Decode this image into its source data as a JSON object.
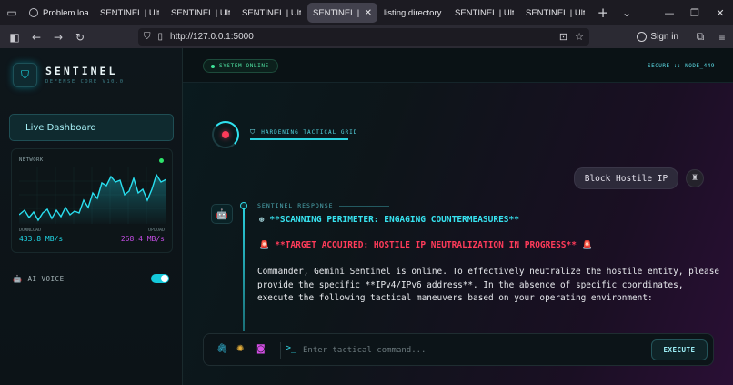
{
  "browser": {
    "tabs": [
      {
        "label": "Problem loadi"
      },
      {
        "label": "SENTINEL | Ultimat"
      },
      {
        "label": "SENTINEL | Ultimat"
      },
      {
        "label": "SENTINEL | Ultimat"
      },
      {
        "label": "SENTINEL | Ultim",
        "active": true
      },
      {
        "label": "listing directory /"
      },
      {
        "label": "SENTINEL | Ultimat"
      },
      {
        "label": "SENTINEL | Ultimat"
      }
    ],
    "url": "http://127.0.0.1:5000",
    "sign_in": "Sign in"
  },
  "sidebar": {
    "brand": "SENTINEL",
    "brand_sub": "DEFENSE CORE V10.0",
    "dashboard_button": "Live Dashboard",
    "network": {
      "title": "NETWORK",
      "download_label": "DOWNLOAD",
      "download_value": "433.8 MB/s",
      "upload_label": "UPLOAD",
      "upload_value": "268.4 MB/s",
      "status_color": "#2ee36b"
    },
    "ai_voice_label": "AI VOICE",
    "ai_voice_on": true
  },
  "header": {
    "status": "SYSTEM ONLINE",
    "secure_label": "SECURE :: NODE_449"
  },
  "chat": {
    "hardening_label": "HARDENING TACTICAL GRID",
    "user_message": "Block Hostile IP",
    "response_label": "SENTINEL RESPONSE",
    "line1": "**SCANNING PERIMETER: ENGAGING COUNTERMEASURES**",
    "line2": "**TARGET ACQUIRED: HOSTILE IP NEUTRALIZATION IN PROGRESS**",
    "body": "Commander, Gemini Sentinel is online. To effectively neutralize the hostile entity, please provide the specific **IPv4/IPv6 address**. In the absence of specific coordinates, execute the following tactical maneuvers based on your operating environment:"
  },
  "composer": {
    "prompt": ">_",
    "placeholder": "Enter tactical command...",
    "execute_label": "EXECUTE"
  },
  "colors": {
    "accent": "#2fe1ef",
    "alert": "#ff3b5a",
    "upload": "#c54ee6"
  }
}
